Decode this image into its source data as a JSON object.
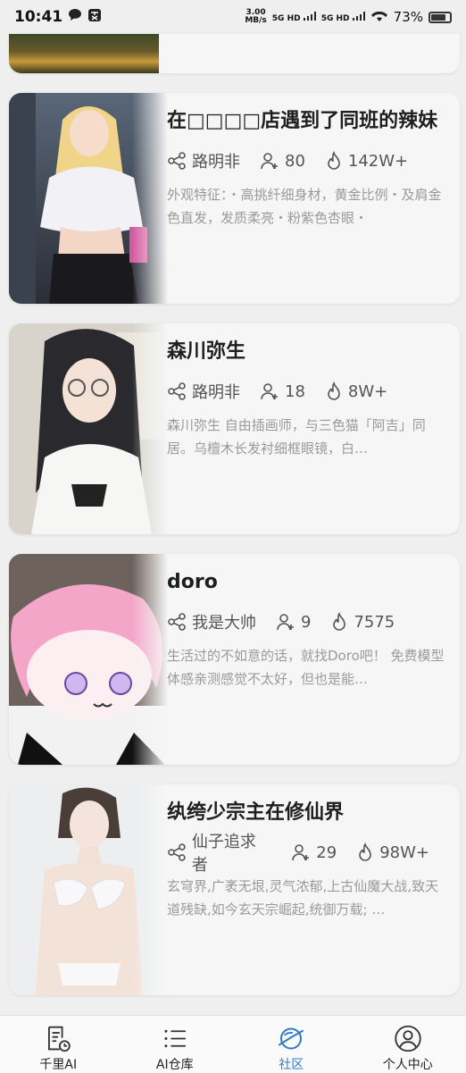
{
  "status": {
    "time": "10:41",
    "net_speed_value": "3.00",
    "net_speed_unit": "MB/s",
    "sig1": "5G HD",
    "sig2": "5G HD",
    "battery": "73%",
    "battery_level": 0.73
  },
  "cards": [
    {
      "title": "在□□□□店遇到了同班的辣妹",
      "author": "路明非",
      "followers": "80",
      "heat": "142W+",
      "desc": "外观特征：・高挑纤细身材，黄金比例・及肩金色直发，发质柔亮・粉紫色杏眼・"
    },
    {
      "title": "森川弥生",
      "author": "路明非",
      "followers": "18",
      "heat": "8W+",
      "desc": "森川弥生 自由插画师，与三色猫「阿吉」同居。乌檀木长发衬细框眼镜，白…"
    },
    {
      "title": "doro",
      "author": "我是大帅",
      "followers": "9",
      "heat": "7575",
      "desc": "生活过的不如意的话，就找Doro吧！ 免费模型体感亲测感觉不太好，但也是能…"
    },
    {
      "title": "纨绔少宗主在修仙界",
      "author": "仙子追求者",
      "followers": "29",
      "heat": "98W+",
      "desc": "玄穹界,广袤无垠,灵气浓郁,上古仙魔大战,致天道残缺,如今玄天宗崛起,统御万载; …"
    }
  ],
  "tabs": [
    {
      "label": "千里AI",
      "icon": "document-clock-icon"
    },
    {
      "label": "AI仓库",
      "icon": "list-icon"
    },
    {
      "label": "社区",
      "icon": "planet-icon",
      "active": true
    },
    {
      "label": "个人中心",
      "icon": "user-icon"
    }
  ],
  "colors": {
    "background": "#efefef",
    "card": "#f6f6f6",
    "active_tab": "#2c7bc4",
    "meta_text": "#555555",
    "desc_text": "#9a9a9a"
  }
}
